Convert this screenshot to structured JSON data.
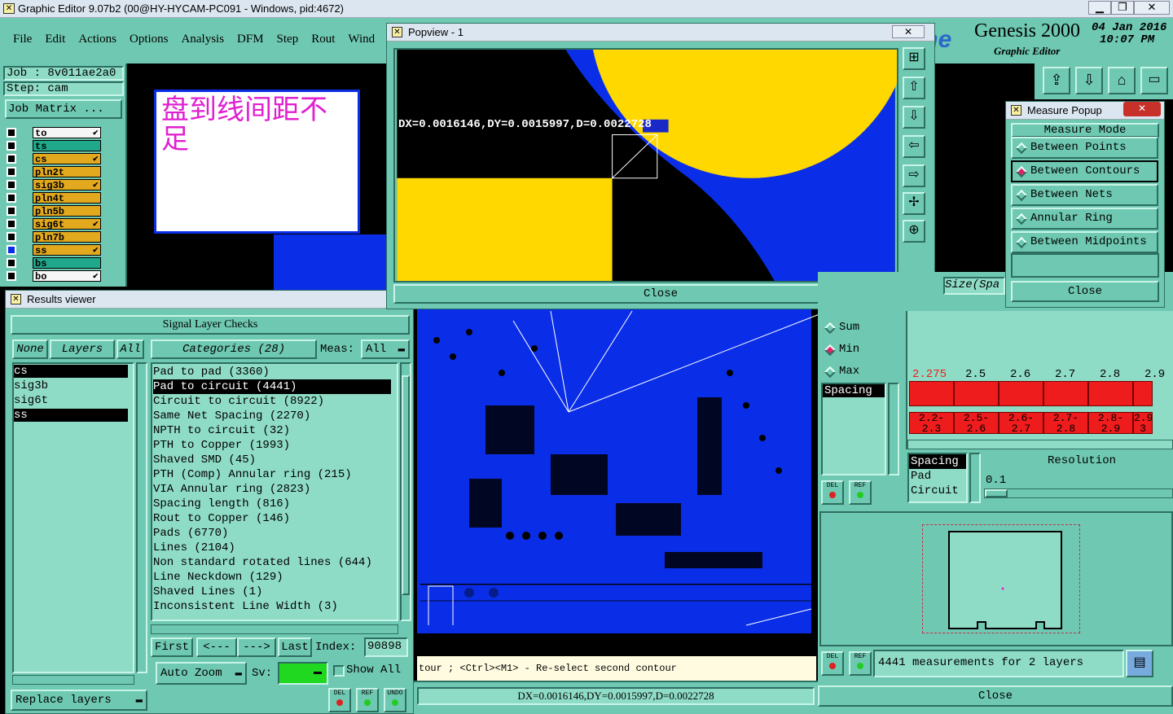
{
  "window_title": "Graphic Editor 9.07b2 (00@HY-HYCAM-PC091 - Windows, pid:4672)",
  "menu": [
    "File",
    "Edit",
    "Actions",
    "Options",
    "Analysis",
    "DFM",
    "Step",
    "Rout",
    "Wind"
  ],
  "brand": {
    "name": "Genesis 2000",
    "subtitle": "Graphic Editor",
    "logo": "Frontline",
    "date": "04 Jan 2016",
    "time": "10:07 PM"
  },
  "job": {
    "job_label": "Job : 8v011ae2a0",
    "step_label": "Step: cam",
    "matrix_btn": "Job Matrix ..."
  },
  "layers": [
    {
      "name": "to",
      "color": "#f6f6f6",
      "sel": true,
      "mark": "✔"
    },
    {
      "name": "ts",
      "color": "#1fa88a",
      "sel": false,
      "mark": ""
    },
    {
      "name": "cs",
      "color": "#e2a81e",
      "sel": false,
      "mark": "✔"
    },
    {
      "name": "pln2t",
      "color": "#e2a81e",
      "sel": false,
      "mark": ""
    },
    {
      "name": "sig3b",
      "color": "#e2a81e",
      "sel": false,
      "mark": "✔"
    },
    {
      "name": "pln4t",
      "color": "#e2a81e",
      "sel": false,
      "mark": ""
    },
    {
      "name": "pln5b",
      "color": "#e2a81e",
      "sel": false,
      "mark": ""
    },
    {
      "name": "sig6t",
      "color": "#e2a81e",
      "sel": false,
      "mark": "✔"
    },
    {
      "name": "pln7b",
      "color": "#e2a81e",
      "sel": false,
      "mark": ""
    },
    {
      "name": "ss",
      "color": "#e2a81e",
      "sel": false,
      "mark": "✔"
    },
    {
      "name": "bs",
      "color": "#1fa88a",
      "sel": false,
      "mark": ""
    },
    {
      "name": "bo",
      "color": "#f6f6f6",
      "sel": true,
      "mark": "✔"
    }
  ],
  "note_text": "盘到线间距不足",
  "results": {
    "title": "Results viewer",
    "header": "Signal Layer Checks",
    "none_btn": "None",
    "layers_btn": "Layers",
    "all_btn": "All",
    "layers_list": [
      "cs",
      "sig3b",
      "sig6t",
      "ss"
    ],
    "categories_btn": "Categories (28)",
    "meas_label": "Meas:",
    "meas_value": "All",
    "categories": [
      "Pad to pad (3360)",
      "Pad to circuit (4441)",
      "Circuit to circuit (8922)",
      "Same Net Spacing (2270)",
      "NPTH to circuit (32)",
      "PTH to Copper (1993)",
      "Shaved SMD (45)",
      "PTH (Comp) Annular ring (215)",
      "VIA Annular ring (2823)",
      "Spacing length (816)",
      "Rout to Copper (146)",
      "Pads (6770)",
      "Lines (2104)",
      "Non standard rotated lines (644)",
      "Line Neckdown (129)",
      "Shaved Lines (1)",
      "Inconsistent Line Width (3)"
    ],
    "first": "First",
    "prev": "<---",
    "next": "--->",
    "last": "Last",
    "index_label": "Index:",
    "index_value": "90898",
    "auto_zoom": "Auto Zoom",
    "sv_label": "Sv:",
    "show_all": "Show All",
    "replace_layers": "Replace layers",
    "del": "DEL",
    "ref": "REF",
    "undo": "UNDO"
  },
  "popview": {
    "title": "Popview - 1",
    "measure_text": "DX=0.0016146,DY=0.0015997,D=0.0022728",
    "close": "Close"
  },
  "measure_popup": {
    "title": "Measure Popup",
    "mode_label": "Measure Mode",
    "modes": [
      {
        "label": "Between Points",
        "on": false
      },
      {
        "label": "Between Contours",
        "on": true
      },
      {
        "label": "Between Nets",
        "on": false
      },
      {
        "label": "Annular Ring",
        "on": false
      },
      {
        "label": "Between Midpoints",
        "on": false
      }
    ],
    "close": "Close"
  },
  "stats": {
    "size_label": "Size(Spa",
    "radio": [
      {
        "label": "Sum",
        "on": false
      },
      {
        "label": "Min",
        "on": true
      },
      {
        "label": "Max",
        "on": false
      }
    ],
    "spacing_list": "Spacing",
    "hist_values": [
      "2.275",
      "2.5",
      "2.6",
      "2.7",
      "2.8",
      "2.9"
    ],
    "hist_ranges": [
      "2.2-\n2.3",
      "2.5-\n2.6",
      "2.6-\n2.7",
      "2.7-\n2.8",
      "2.8-\n2.9",
      "2.9-\n3"
    ],
    "types": [
      "Spacing",
      "Pad",
      "Circuit"
    ],
    "resolution_label": "Resolution",
    "resolution_value": "0.1",
    "summary": "4441 measurements for 2 layers",
    "close": "Close"
  },
  "status_line": "tour ; <Ctrl><M1> - Re-select second contour",
  "bottom_measure": "DX=0.0016146,DY=0.0015997,D=0.0022728",
  "colors": {
    "teal": "#6fc9b2",
    "blue": "#0a2ee8",
    "yellow": "#ffd800",
    "red": "#ee1c1c",
    "magenta": "#e020d0"
  }
}
